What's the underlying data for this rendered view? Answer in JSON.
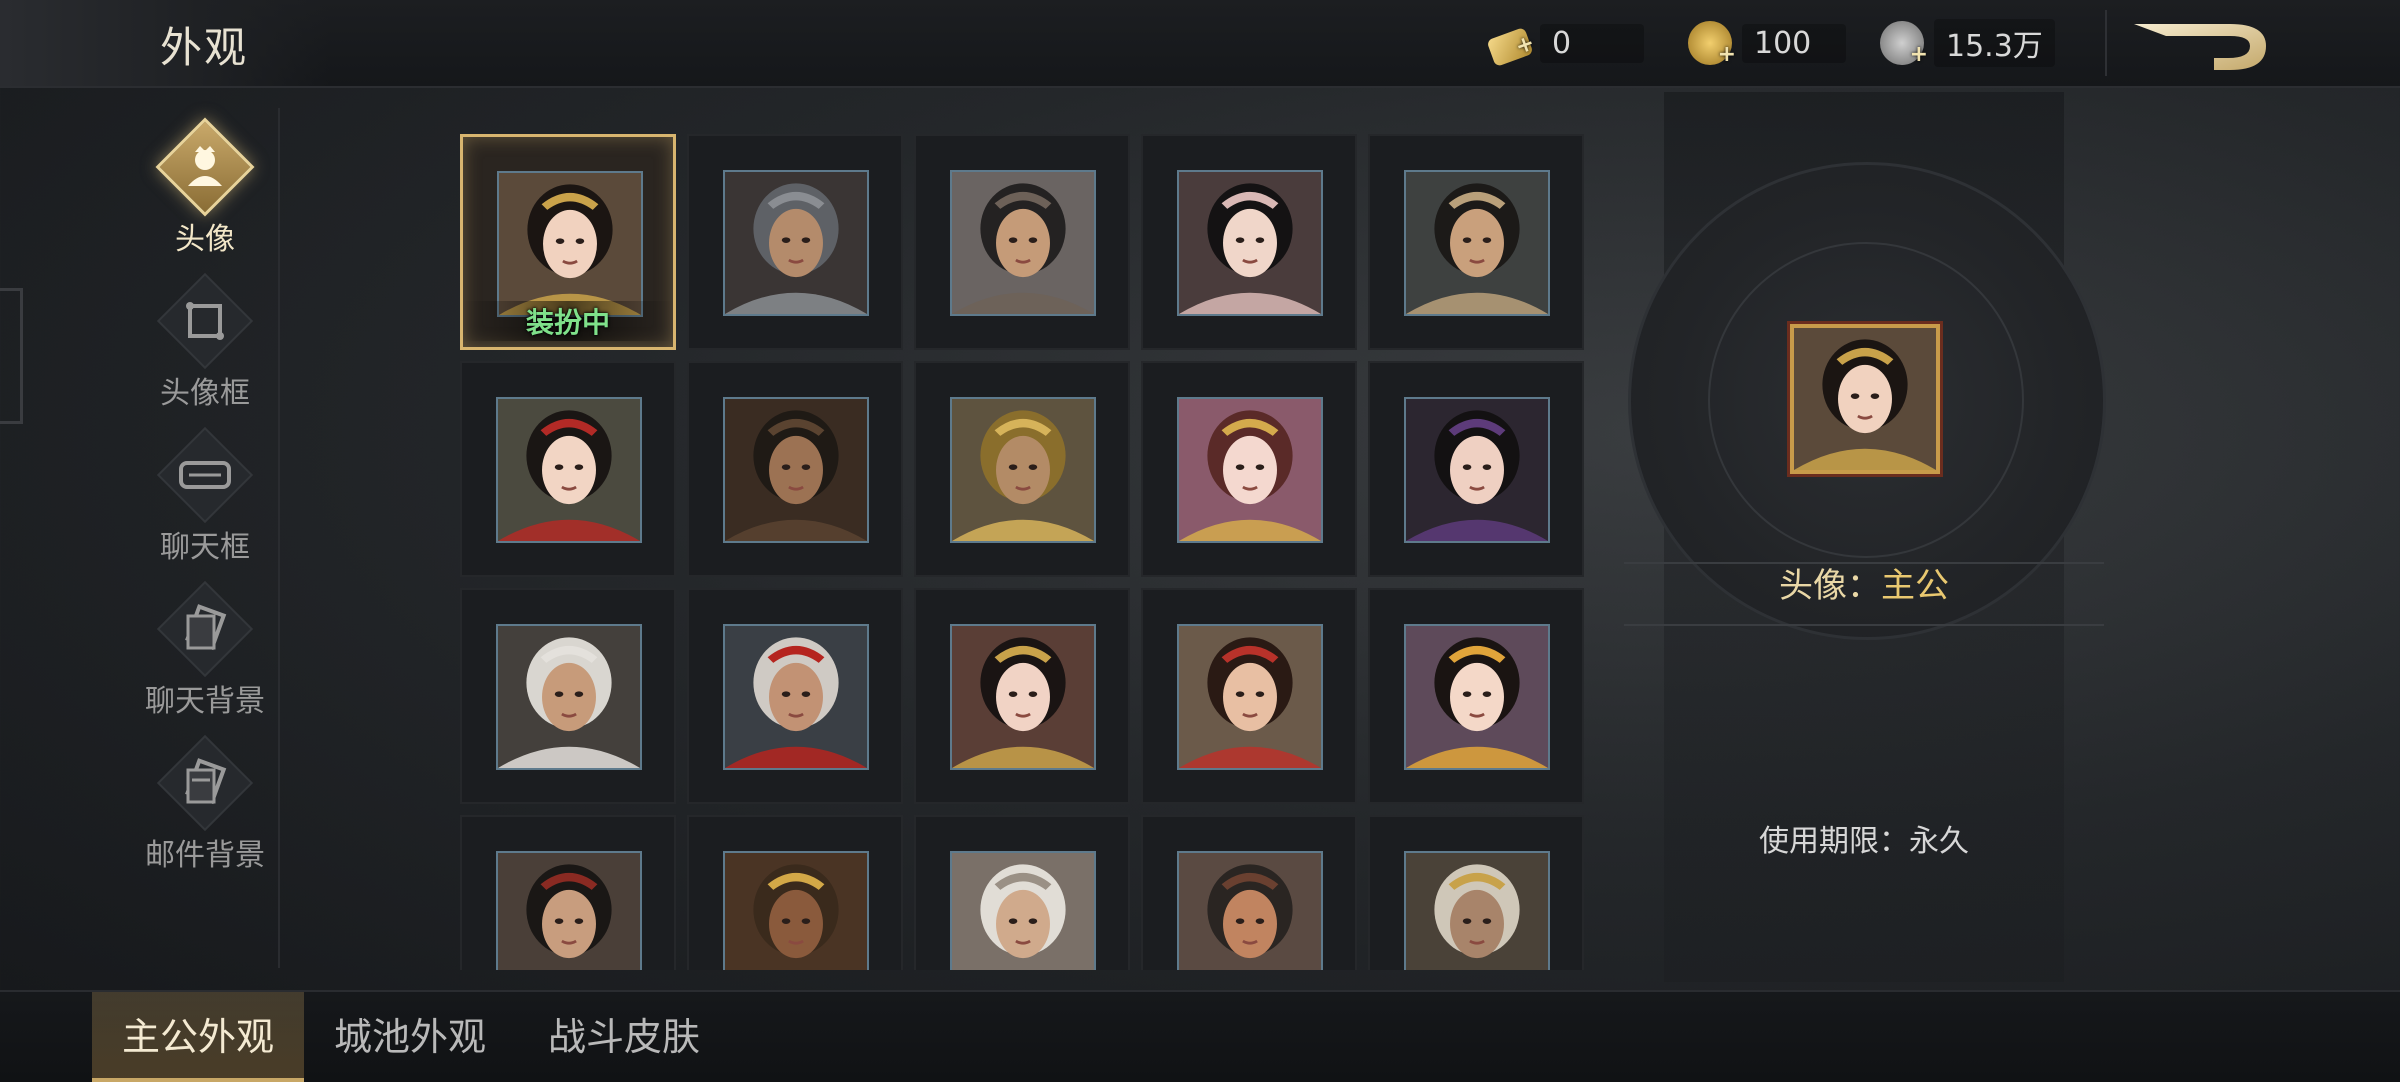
{
  "header": {
    "title": "外观",
    "currencies": [
      {
        "icon": "gold-ingot-icon",
        "value": "0"
      },
      {
        "icon": "gold-coin-icon",
        "value": "100"
      },
      {
        "icon": "copper-coin-icon",
        "value": "15.3万"
      }
    ],
    "back_icon": "back-arrow-icon"
  },
  "sidebar": {
    "items": [
      {
        "label": "头像",
        "icon": "portrait-icon",
        "active": true
      },
      {
        "label": "头像框",
        "icon": "frame-icon",
        "active": false
      },
      {
        "label": "聊天框",
        "icon": "chat-bubble-icon",
        "active": false
      },
      {
        "label": "聊天背景",
        "icon": "chat-background-icon",
        "active": false
      },
      {
        "label": "邮件背景",
        "icon": "mail-background-icon",
        "active": false
      }
    ]
  },
  "grid": {
    "equipped_label": "装扮中",
    "avatars": [
      {
        "name": "avatar-female-lord",
        "hair": "#1b1512",
        "skin": "#f1d2bf",
        "accent": "#c9a24a",
        "bg": "#5b4a3a"
      },
      {
        "name": "avatar-armored-warrior",
        "hair": "#5e6166",
        "skin": "#b48b6b",
        "accent": "#8a8d92",
        "bg": "#3a3534"
      },
      {
        "name": "avatar-bearded-general",
        "hair": "#242222",
        "skin": "#c59b78",
        "accent": "#6d6158",
        "bg": "#6a6462"
      },
      {
        "name": "avatar-female-dark-hair",
        "hair": "#141213",
        "skin": "#f0d6c9",
        "accent": "#d9b8b5",
        "bg": "#4a3c3c"
      },
      {
        "name": "avatar-straw-hat-man",
        "hair": "#1c1a18",
        "skin": "#c9a07c",
        "accent": "#b9a07a",
        "bg": "#3e4140"
      },
      {
        "name": "avatar-female-red-flower",
        "hair": "#1a1614",
        "skin": "#f2d5c4",
        "accent": "#b22a26",
        "bg": "#4b4a3f"
      },
      {
        "name": "avatar-fierce-warrior",
        "hair": "#1f1a15",
        "skin": "#9c7253",
        "accent": "#5a4330",
        "bg": "#3a2c22"
      },
      {
        "name": "avatar-golden-helmet",
        "hair": "#8a6e2c",
        "skin": "#b38b66",
        "accent": "#d6b35a",
        "bg": "#5e533f"
      },
      {
        "name": "avatar-female-gold-crown",
        "hair": "#5a2a28",
        "skin": "#f4d8cf",
        "accent": "#d4aa4c",
        "bg": "#8a5a6b"
      },
      {
        "name": "avatar-female-purple",
        "hair": "#131112",
        "skin": "#efd0c2",
        "accent": "#5d3b7a",
        "bg": "#2c2630"
      },
      {
        "name": "avatar-white-beard-elder",
        "hair": "#d9d6d0",
        "skin": "#c79b7a",
        "accent": "#e4e1dc",
        "bg": "#44403c"
      },
      {
        "name": "avatar-red-headband-elder",
        "hair": "#cfcac4",
        "skin": "#c29274",
        "accent": "#b5241f",
        "bg": "#3a3f45"
      },
      {
        "name": "avatar-female-ornate",
        "hair": "#1a1413",
        "skin": "#f1d3c5",
        "accent": "#c9a24a",
        "bg": "#5a3e36"
      },
      {
        "name": "avatar-female-red-band",
        "hair": "#2a1a14",
        "skin": "#e8bfa3",
        "accent": "#b8322a",
        "bg": "#6b5a4a"
      },
      {
        "name": "avatar-young-girl",
        "hair": "#1a1412",
        "skin": "#f4d8c8",
        "accent": "#e0a43a",
        "bg": "#5e4a5a"
      },
      {
        "name": "avatar-mustache-noble",
        "hair": "#1a1715",
        "skin": "#c89d7e",
        "accent": "#8a2a22",
        "bg": "#4a3f38"
      },
      {
        "name": "avatar-golden-beast",
        "hair": "#3a2a1c",
        "skin": "#8a5a3c",
        "accent": "#d3a847",
        "bg": "#4a3424"
      },
      {
        "name": "avatar-white-hair-sage",
        "hair": "#e1ddd6",
        "skin": "#d0aa8c",
        "accent": "#9a9085",
        "bg": "#7a7068"
      },
      {
        "name": "avatar-angry-warrior",
        "hair": "#2a2522",
        "skin": "#c18460",
        "accent": "#6a4030",
        "bg": "#5a4a42"
      },
      {
        "name": "avatar-gold-armor-elder",
        "hair": "#cfc7b8",
        "skin": "#a8846a",
        "accent": "#c8a24a",
        "bg": "#4a4238"
      }
    ]
  },
  "detail": {
    "title_key": "头像：",
    "title_value": "主公",
    "usage": "使用期限：永久"
  },
  "tabs": [
    {
      "label": "主公外观",
      "active": true
    },
    {
      "label": "城池外观",
      "active": false
    },
    {
      "label": "战斗皮肤",
      "active": false
    }
  ]
}
